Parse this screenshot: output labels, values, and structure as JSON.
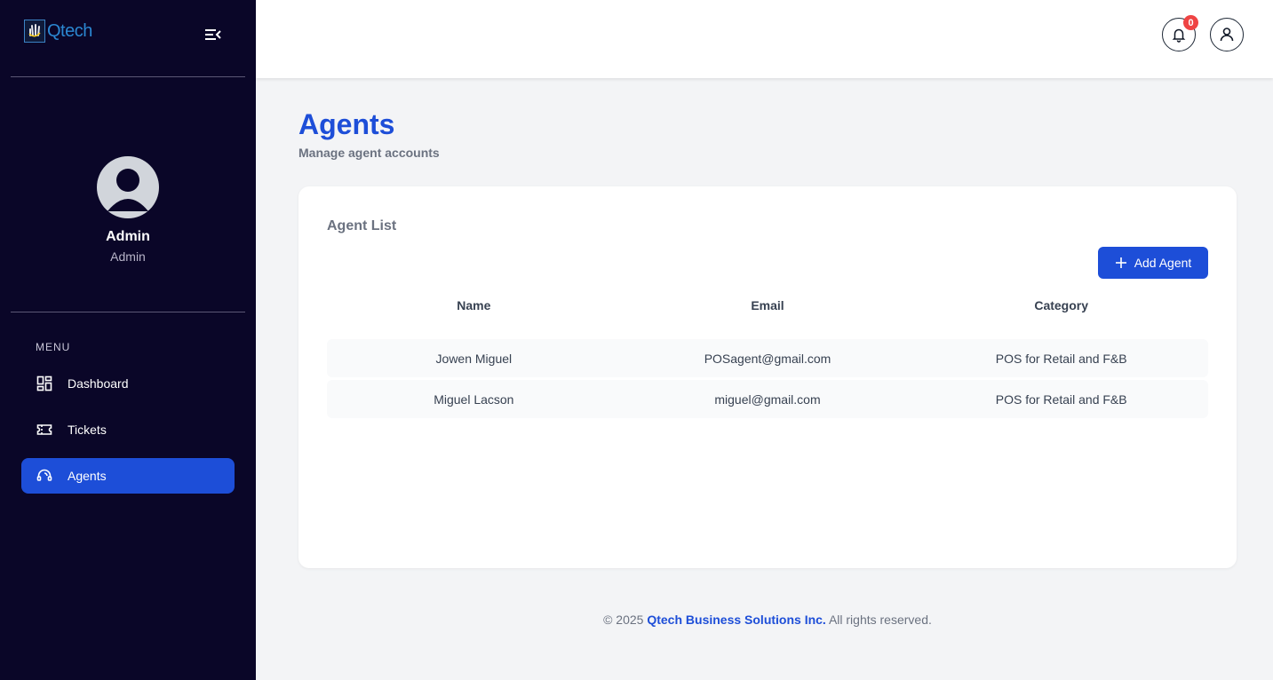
{
  "brand": {
    "logo_text": "Qtech",
    "icon": "qtech-hand-logo"
  },
  "sidebar": {
    "toggle_icon": "collapse-menu-icon",
    "user": {
      "name": "Admin",
      "role": "Admin"
    },
    "menu_label": "MENU",
    "items": [
      {
        "label": "Dashboard",
        "icon": "dashboard-icon",
        "active": false
      },
      {
        "label": "Tickets",
        "icon": "ticket-icon",
        "active": false
      },
      {
        "label": "Agents",
        "icon": "headset-icon",
        "active": true
      }
    ]
  },
  "topbar": {
    "notification_count": "0",
    "bell_icon": "bell-icon",
    "user_icon": "user-icon"
  },
  "page": {
    "title": "Agents",
    "subtitle": "Manage agent accounts"
  },
  "card": {
    "title": "Agent List",
    "add_button_label": "Add Agent",
    "columns": [
      "Name",
      "Email",
      "Category"
    ],
    "rows": [
      {
        "name": "Jowen Miguel",
        "email": "POSagent@gmail.com",
        "category": "POS for Retail and F&B"
      },
      {
        "name": "Miguel Lacson",
        "email": "miguel@gmail.com",
        "category": "POS for Retail and F&B"
      }
    ]
  },
  "footer": {
    "prefix": "© 2025 ",
    "company": "Qtech Business Solutions Inc.",
    "suffix": " All rights reserved."
  },
  "colors": {
    "sidebar_bg": "#0a0628",
    "accent": "#1d4ed8",
    "badge": "#ef4444"
  }
}
